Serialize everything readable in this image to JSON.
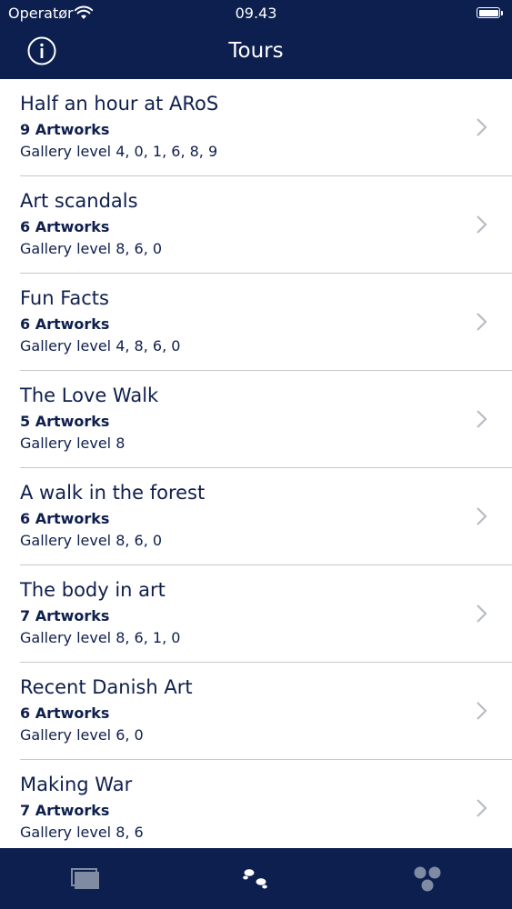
{
  "status_bar": {
    "carrier": "Operatør",
    "time": "09.43",
    "wifi_icon": "wifi-icon",
    "battery_icon": "battery-icon"
  },
  "header": {
    "title": "Tours",
    "info_icon": "info-icon",
    "background_color": "#0c1f4f"
  },
  "tours": [
    {
      "title": "Half an hour at ARoS",
      "artworks": "9 Artworks",
      "levels": "Gallery level 4, 0, 1, 6, 8, 9"
    },
    {
      "title": "Art scandals",
      "artworks": "6 Artworks",
      "levels": "Gallery level 8, 6, 0"
    },
    {
      "title": "Fun Facts",
      "artworks": "6 Artworks",
      "levels": "Gallery level 4, 8, 6, 0"
    },
    {
      "title": "The Love Walk",
      "artworks": "5 Artworks",
      "levels": "Gallery level 8"
    },
    {
      "title": "A walk in the forest",
      "artworks": "6 Artworks",
      "levels": "Gallery level 8, 6, 0"
    },
    {
      "title": "The body in art",
      "artworks": "7 Artworks",
      "levels": "Gallery level 8, 6, 1, 0"
    },
    {
      "title": "Recent Danish Art",
      "artworks": "6 Artworks",
      "levels": "Gallery level 6, 0"
    },
    {
      "title": "Making War",
      "artworks": "7 Artworks",
      "levels": "Gallery level 8, 6"
    }
  ],
  "tab_bar": {
    "tabs": [
      {
        "icon": "stacked-cards-icon",
        "selected": false
      },
      {
        "icon": "footprints-icon",
        "selected": true
      },
      {
        "icon": "three-dots-icon",
        "selected": false
      }
    ],
    "selected_color": "#ffffff",
    "unselected_color": "#7f8aa3"
  }
}
